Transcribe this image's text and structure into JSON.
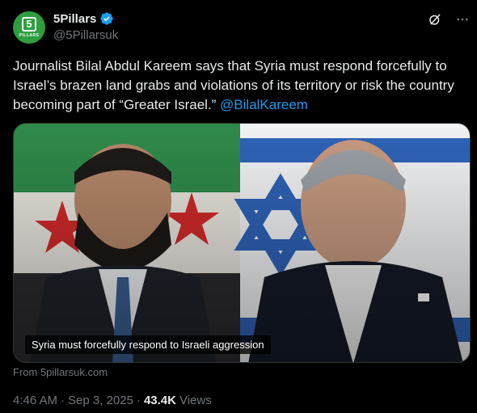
{
  "account": {
    "display_name": "5Pillars",
    "handle": "@5Pillarsuk",
    "avatar_number": "5",
    "avatar_text": "PILLARS",
    "verified": true
  },
  "tweet": {
    "text": "Journalist Bilal Abdul Kareem says that Syria must respond forcefully to Israel’s brazen land grabs and violations of its territory or risk the country becoming part of “Greater Israel.” ",
    "mention": "@BilalKareem"
  },
  "media": {
    "caption": "Syria must forcefully respond to Israeli aggression"
  },
  "card": {
    "source": "From 5pillarsuk.com"
  },
  "meta": {
    "time": "4:46 AM",
    "dot1": "·",
    "date": "Sep 3, 2025",
    "dot2": "·",
    "views_count": "43.4K",
    "views_label": "Views"
  },
  "icons": {
    "verified": "verified-badge-icon",
    "grok": "grok-icon",
    "more": "more-icon"
  },
  "colors": {
    "background": "#000000",
    "text": "#e7e9ea",
    "muted": "#71767b",
    "accent": "#1d9bf0",
    "avatar_bg": "#2e9e3f"
  }
}
